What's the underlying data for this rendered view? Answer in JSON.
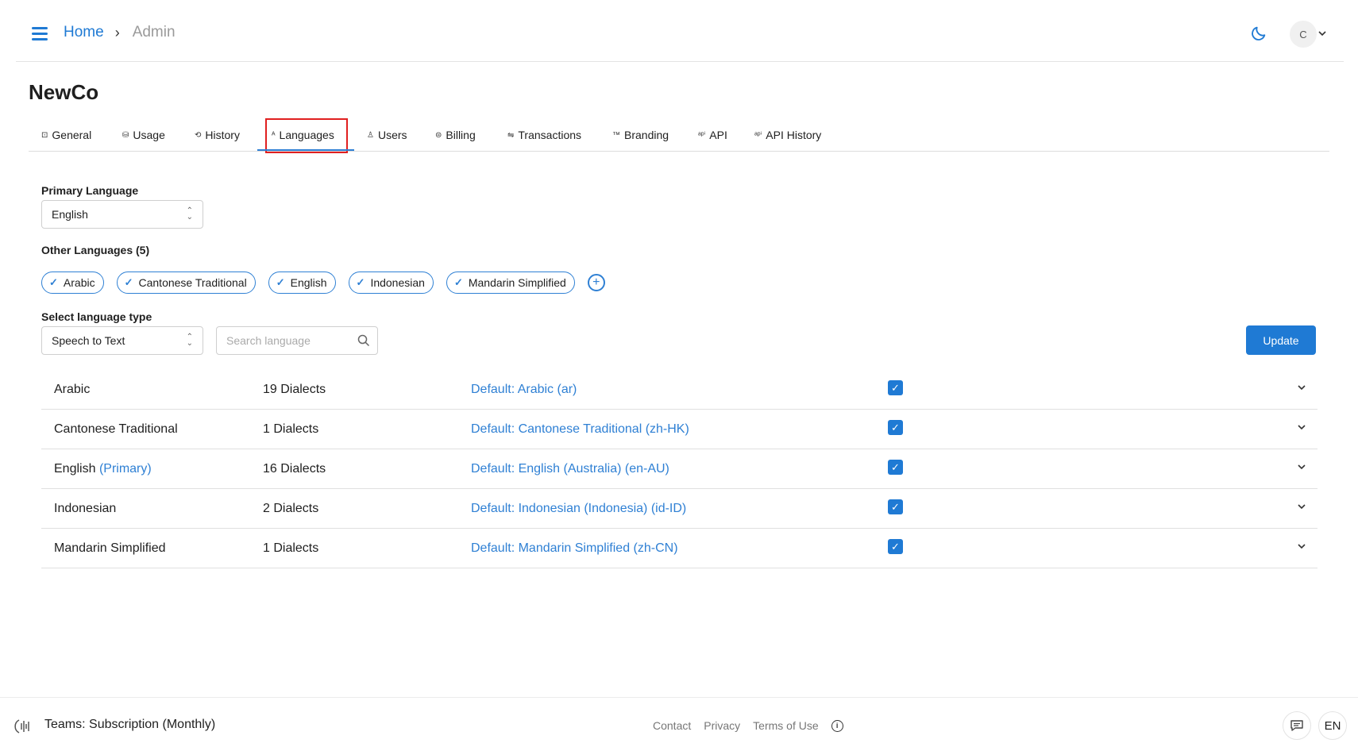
{
  "colors": {
    "accent": "#1f7ad4",
    "highlight": "#e02020",
    "text": "#1f1f1f"
  },
  "header": {
    "breadcrumb": {
      "home": "Home",
      "separator": "›",
      "current": "Admin"
    },
    "user_initial": "C"
  },
  "page_title": "NewCo",
  "tabs": [
    {
      "label": "General",
      "icon": "square-icon",
      "glyph": "⊡"
    },
    {
      "label": "Usage",
      "icon": "cylinder-icon",
      "glyph": "⛁"
    },
    {
      "label": "History",
      "icon": "history-icon",
      "glyph": "⟲"
    },
    {
      "label": "Languages",
      "icon": "translate-icon",
      "glyph": "ᴬ",
      "active": true
    },
    {
      "label": "Users",
      "icon": "user-icon",
      "glyph": "♙"
    },
    {
      "label": "Billing",
      "icon": "coins-icon",
      "glyph": "⊜"
    },
    {
      "label": "Transactions",
      "icon": "arrows-icon",
      "glyph": "⇋"
    },
    {
      "label": "Branding",
      "icon": "trademark-icon",
      "glyph": "™"
    },
    {
      "label": "API",
      "icon": "api-icon",
      "glyph": "ᵃᵖⁱ"
    },
    {
      "label": "API History",
      "icon": "api-icon",
      "glyph": "ᵃᵖⁱ"
    }
  ],
  "primary_language": {
    "label": "Primary Language",
    "value": "English"
  },
  "other_languages": {
    "label": "Other Languages (5)",
    "chips": [
      "Arabic",
      "Cantonese Traditional",
      "English",
      "Indonesian",
      "Mandarin Simplified"
    ]
  },
  "language_type": {
    "label": "Select language type",
    "value": "Speech to Text"
  },
  "search": {
    "placeholder": "Search language",
    "value": ""
  },
  "update_label": "Update",
  "languages": [
    {
      "name": "Arabic",
      "primary_tag": "",
      "dialects": "19 Dialects",
      "default": "Default: Arabic (ar)",
      "checked": true
    },
    {
      "name": "Cantonese Traditional",
      "primary_tag": "",
      "dialects": "1 Dialects",
      "default": "Default: Cantonese Traditional (zh-HK)",
      "checked": true
    },
    {
      "name": "English",
      "primary_tag": "(Primary)",
      "dialects": "16 Dialects",
      "default": "Default: English (Australia) (en-AU)",
      "checked": true
    },
    {
      "name": "Indonesian",
      "primary_tag": "",
      "dialects": "2 Dialects",
      "default": "Default: Indonesian (Indonesia) (id-ID)",
      "checked": true
    },
    {
      "name": "Mandarin Simplified",
      "primary_tag": "",
      "dialects": "1 Dialects",
      "default": "Default: Mandarin Simplified (zh-CN)",
      "checked": true
    }
  ],
  "footer": {
    "plan": "Teams: Subscription (Monthly)",
    "links": [
      "Contact",
      "Privacy",
      "Terms of Use"
    ],
    "lang": "EN"
  }
}
